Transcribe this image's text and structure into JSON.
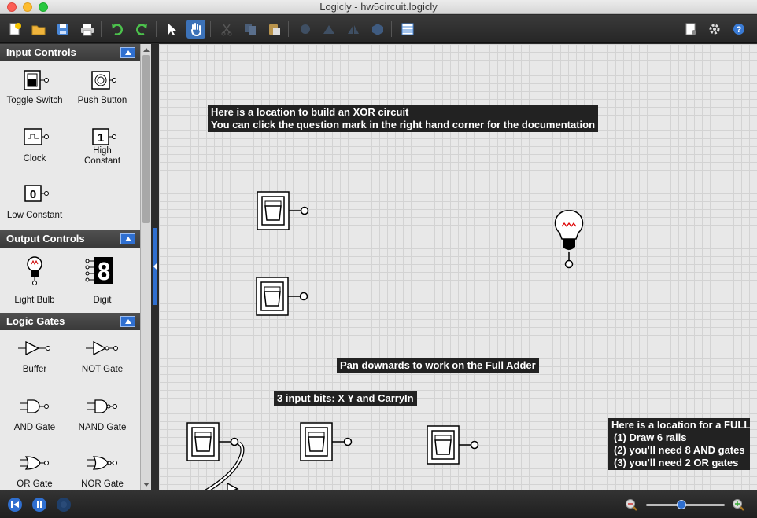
{
  "window": {
    "title": "Logicly - hw5circuit.logicly"
  },
  "toolbar": {
    "buttons": [
      "new-icon",
      "open-icon",
      "save-icon",
      "print-icon",
      "undo-icon",
      "redo-icon",
      "select-icon",
      "pan-icon",
      "cut-icon",
      "copy-icon",
      "paste-icon",
      "rotate-icon",
      "flip-horizontal-icon",
      "flip-vertical-icon",
      "group-icon",
      "grid-icon",
      "export-icon",
      "settings-icon",
      "help-icon"
    ],
    "accent": "#3c72b8"
  },
  "sidebar": {
    "input_controls": {
      "title": "Input Controls",
      "items": [
        "Toggle Switch",
        "Push Button",
        "Clock",
        "High Constant",
        "Low Constant"
      ],
      "glyphs": {
        "high": "1",
        "low": "0"
      }
    },
    "output_controls": {
      "title": "Output Controls",
      "items": [
        "Light Bulb",
        "Digit"
      ],
      "digit_glyph": "8"
    },
    "logic_gates": {
      "title": "Logic Gates",
      "items": [
        "Buffer",
        "NOT Gate",
        "AND Gate",
        "NAND Gate",
        "OR Gate",
        "NOR Gate"
      ]
    }
  },
  "canvas": {
    "labels": {
      "xor_line1": "Here is a location to build an XOR circuit",
      "xor_line2": "You can click the question mark in the right hand corner for the documentation",
      "pan_down": "Pan downards to work on the Full Adder",
      "input_bits": "3 input bits: X Y and CarryIn",
      "full_adder_title": "Here is a location for a FULL",
      "full_adder_step1": "(1) Draw 6 rails",
      "full_adder_step2": "(2) you'll need 8 AND gates",
      "full_adder_step3": "(3) you'll need 2 OR gates"
    },
    "components": [
      "toggle-switch",
      "toggle-switch",
      "light-bulb",
      "toggle-switch",
      "toggle-switch",
      "toggle-switch"
    ]
  },
  "statusbar": {
    "buttons": [
      "rewind-icon",
      "pause-icon",
      "step-icon"
    ],
    "zoom_level": 0.45
  },
  "colors": {
    "label_bg": "#222222",
    "canvas_bg": "#e8e8e8",
    "accent_blue": "#2f6fd0"
  }
}
